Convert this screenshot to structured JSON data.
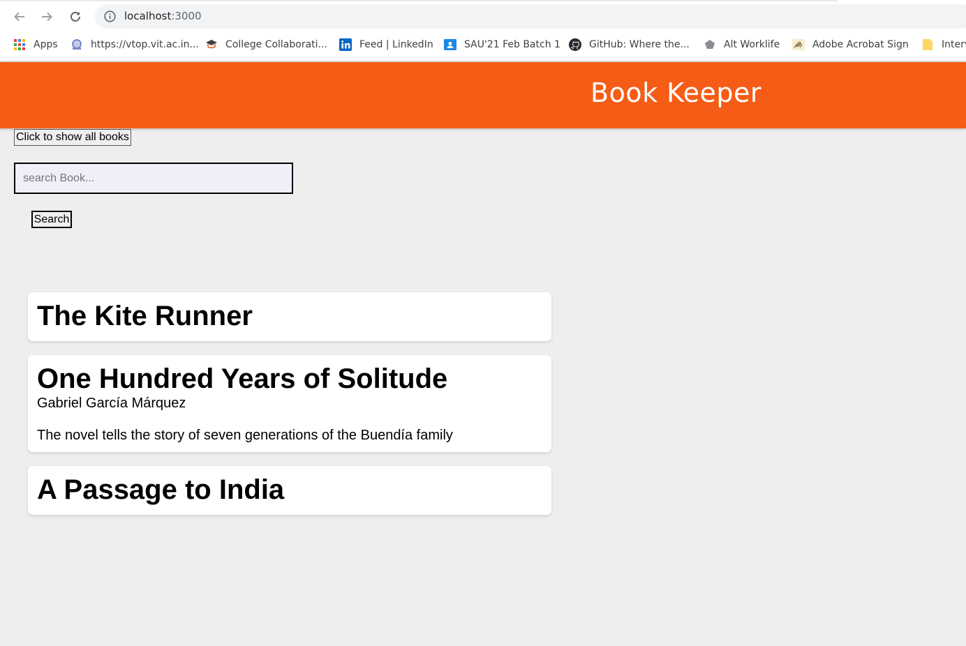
{
  "browser": {
    "url_host": "localhost",
    "url_port": ":3000",
    "bookmarks": [
      {
        "label": "Apps",
        "icon": "apps-grid-icon"
      },
      {
        "label": "https://vtop.vit.ac.in...",
        "icon": "vtop-icon"
      },
      {
        "label": "College Collaborati...",
        "icon": "graduation-cap-icon"
      },
      {
        "label": "Feed | LinkedIn",
        "icon": "linkedin-icon"
      },
      {
        "label": "SAU'21 Feb Batch 1",
        "icon": "google-classroom-icon"
      },
      {
        "label": "GitHub: Where the...",
        "icon": "github-icon"
      },
      {
        "label": "Alt Worklife",
        "icon": "alt-worklife-icon"
      },
      {
        "label": "Adobe Acrobat Sign",
        "icon": "adobe-sign-icon"
      },
      {
        "label": "Interv",
        "icon": "folder-icon"
      }
    ]
  },
  "app": {
    "title": "Book Keeper",
    "show_all_label": "Click to show all books",
    "search_placeholder": "search Book...",
    "search_value": "",
    "search_label": "Search"
  },
  "books": [
    {
      "title": "The Kite Runner",
      "author": "",
      "description": ""
    },
    {
      "title": "One Hundred Years of Solitude",
      "author": "Gabriel García Márquez",
      "description": "The novel tells the story of seven generations of the Buendía family"
    },
    {
      "title": "A Passage to India",
      "author": "",
      "description": ""
    }
  ],
  "colors": {
    "header": "#f55c15",
    "background": "#eeeeee",
    "card": "#ffffff"
  }
}
